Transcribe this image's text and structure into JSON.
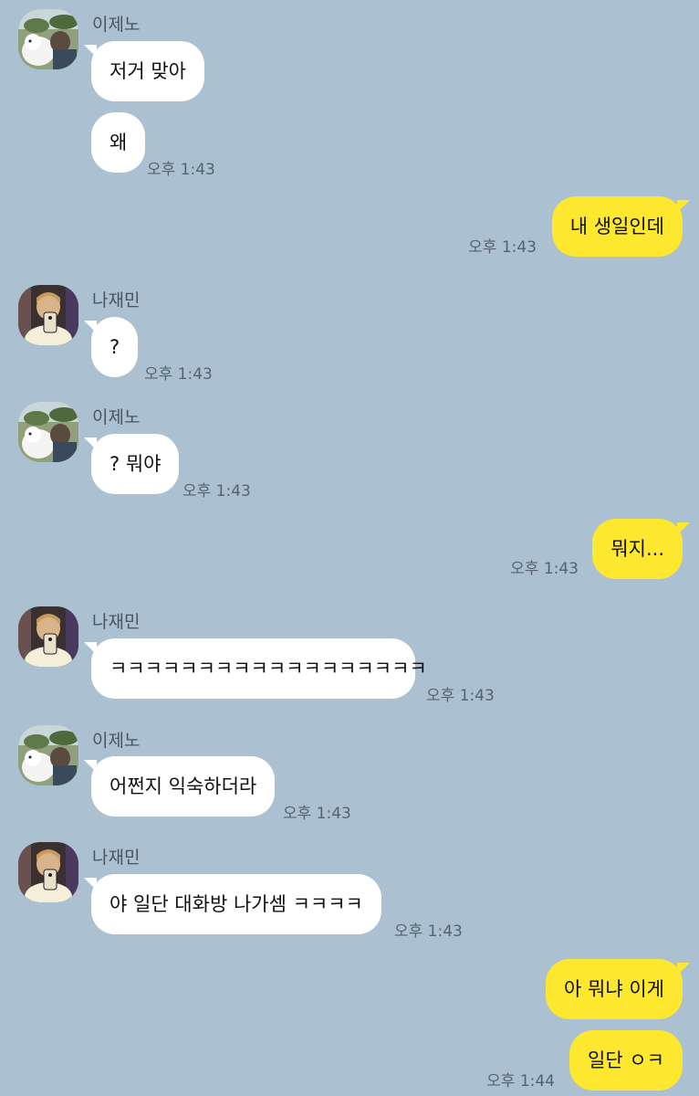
{
  "users": {
    "jeno": "이제노",
    "jaemin": "나재민"
  },
  "messages": [
    {
      "text": "저거 맞아"
    },
    {
      "text": "왜",
      "time": "오후 1:43"
    },
    {
      "text": "내 생일인데",
      "time": "오후 1:43"
    },
    {
      "text": "?",
      "time": "오후 1:43"
    },
    {
      "text": "? 뭐야",
      "time": "오후 1:43"
    },
    {
      "text": "뭐지...",
      "time": "오후 1:43"
    },
    {
      "text": "ㅋㅋㅋㅋㅋㅋㅋㅋㅋㅋㅋㅋㅋㅋㅋㅋㅋㅋ",
      "time": "오후 1:43"
    },
    {
      "text": "어쩐지 익숙하더라",
      "time": "오후 1:43"
    },
    {
      "text": "야 일단 대화방 나가셈 ㅋㅋㅋㅋ",
      "time": "오후 1:43"
    },
    {
      "text": "아 뭐냐 이게"
    },
    {
      "text": "일단 ㅇㅋ",
      "time": "오후 1:44"
    }
  ],
  "colors": {
    "background": "#abc1d1",
    "incoming_bubble": "#ffffff",
    "outgoing_bubble": "#fde72f"
  },
  "avatar_icons": {
    "jeno": "profile-photo-man-with-white-dog",
    "jaemin": "profile-photo-mirror-selfie"
  }
}
